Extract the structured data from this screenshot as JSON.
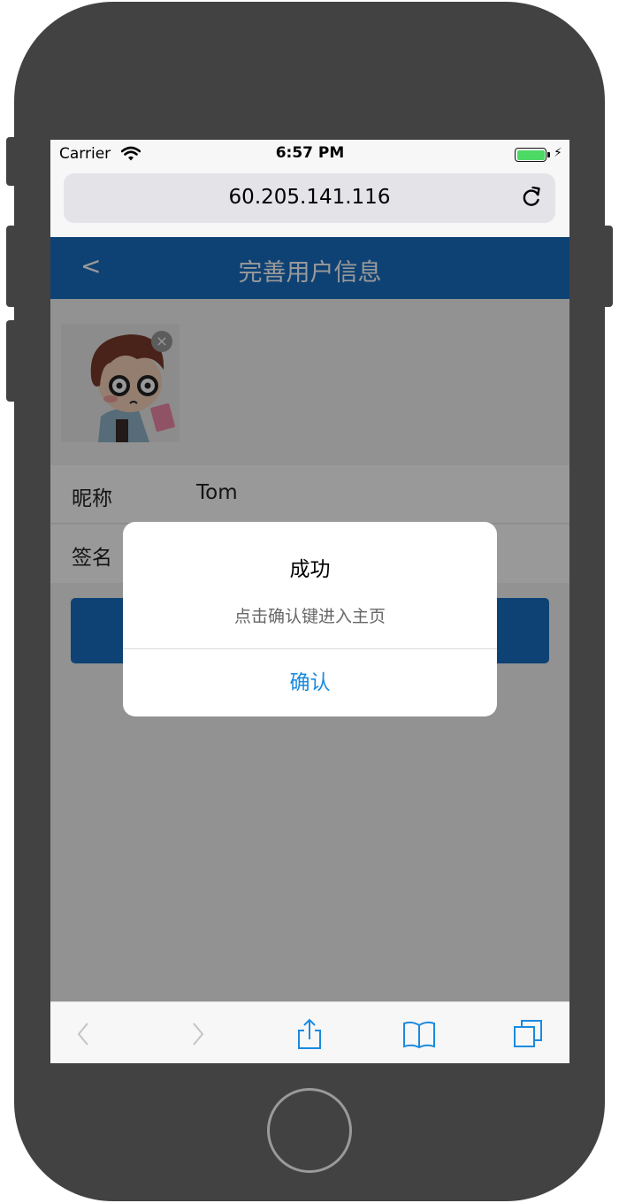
{
  "status_bar": {
    "carrier": "Carrier",
    "time": "6:57 PM",
    "icons": [
      "wifi-icon",
      "battery-icon",
      "charging-bolt-icon"
    ]
  },
  "browser": {
    "url": "60.205.141.116",
    "reload_icon": "reload-icon"
  },
  "nav": {
    "back_label": "<",
    "title": "完善用户信息"
  },
  "avatar": {
    "remove_label": "×"
  },
  "form": {
    "nickname_label": "昵称",
    "nickname_value": "Tom",
    "signature_label": "签名",
    "signature_value": ""
  },
  "alert": {
    "title": "成功",
    "message": "点击确认键进入主页",
    "confirm_label": "确认"
  },
  "toolbar": {
    "items": [
      "back-icon",
      "forward-icon",
      "share-icon",
      "bookmarks-icon",
      "tabs-icon"
    ]
  },
  "colors": {
    "nav_blue": "#1a6fc2",
    "link_blue": "#1a8ae0",
    "phone_body": "#424242",
    "battery_green": "#4cd964"
  }
}
